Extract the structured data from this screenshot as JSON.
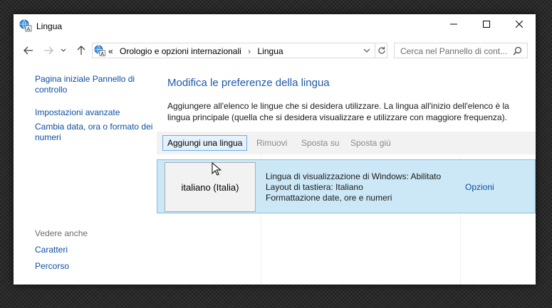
{
  "window": {
    "title": "Lingua"
  },
  "address_bar": {
    "prefix": "«",
    "crumbs": [
      "Orologio e opzioni internazionali",
      "Lingua"
    ],
    "separator": "›"
  },
  "search": {
    "placeholder": "Cerca nel Pannello di cont..."
  },
  "sidebar": {
    "home_link": "Pagina iniziale Pannello di controllo",
    "links": [
      "Impostazioni avanzate",
      "Cambia data, ora o formato dei numeri"
    ],
    "see_also_label": "Vedere anche",
    "see_also": [
      "Caratteri",
      "Percorso"
    ]
  },
  "main": {
    "title": "Modifica le preferenze della lingua",
    "description": "Aggiungere all'elenco le lingue che si desidera utilizzare. La lingua all'inizio dell'elenco è la lingua principale (quella che si desidera visualizzare e utilizzare con maggiore frequenza)."
  },
  "toolbar": {
    "add": "Aggiungi una lingua",
    "remove": "Rimuovi",
    "move_up": "Sposta su",
    "move_down": "Sposta giù"
  },
  "languages": [
    {
      "name": "italiano (Italia)",
      "details": [
        "Lingua di visualizzazione di Windows: Abilitato",
        "Layout di tastiera: Italiano",
        "Formattazione date, ore e numeri"
      ],
      "options_label": "Opzioni"
    }
  ],
  "colors": {
    "link": "#0c4fa3",
    "title": "#1e5aa8",
    "selection": "#cce8f6",
    "selection_border": "#7fc0e4"
  }
}
